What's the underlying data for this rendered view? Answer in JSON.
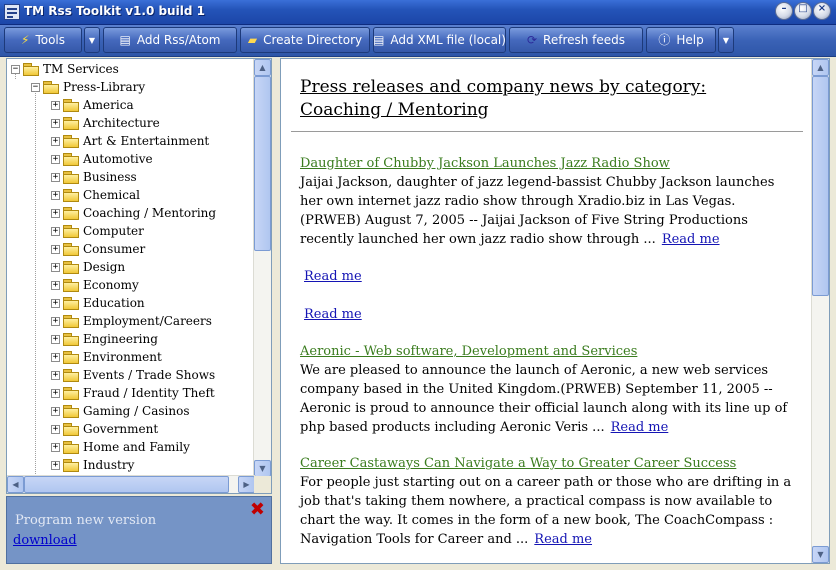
{
  "window": {
    "title": "TM Rss Toolkit v1.0 build 1"
  },
  "toolbar": {
    "tools_label": "Tools",
    "add_rss_label": "Add Rss/Atom",
    "create_dir_label": "Create Directory",
    "add_xml_label": "Add XML file (local)",
    "refresh_label": "Refresh feeds",
    "help_label": "Help"
  },
  "tree": {
    "root": "TM Services",
    "library": "Press-Library",
    "categories": [
      "America",
      "Architecture",
      "Art & Entertainment",
      "Automotive",
      "Business",
      "Chemical",
      "Coaching / Mentoring",
      "Computer",
      "Consumer",
      "Design",
      "Economy",
      "Education",
      "Employment/Careers",
      "Engineering",
      "Environment",
      "Events / Trade Shows",
      "Fraud / Identity Theft",
      "Gaming / Casinos",
      "Government",
      "Home and Family",
      "Industry"
    ]
  },
  "update": {
    "text": "Program new version",
    "link": "download"
  },
  "content": {
    "heading": "Press releases and company news by category: Coaching / Mentoring",
    "read_me": "Read me",
    "items": [
      {
        "title": "Daughter of Chubby Jackson Launches Jazz Radio Show",
        "body": "Jaijai Jackson, daughter of jazz legend-bassist Chubby Jackson launches her own internet jazz radio show through Xradio.biz in Las Vegas.(PRWEB) August 7, 2005 -- Jaijai Jackson of Five String Productions recently launched her own jazz radio show through ..."
      },
      {
        "title": "Aeronic - Web software, Development and Services",
        "body": "We are pleased to announce the launch of Aeronic, a new web services company based in the United Kingdom.(PRWEB) September 11, 2005 -- Aeronic is proud to announce their official launch along with its line up of php based products including Aeronic Veris ..."
      },
      {
        "title": "Career Castaways Can Navigate a Way to Greater Career Success",
        "body": "For people just starting out on a career path or those who are drifting in a job that's taking them nowhere, a practical compass is now available to chart the way. It comes in the form of a new book, The CoachCompass : Navigation Tools for Career and ..."
      }
    ]
  },
  "colors": {
    "accent": "#2e56a8",
    "link": "#1414b4",
    "title_link": "#3a7c1e",
    "close": "#c00000"
  }
}
